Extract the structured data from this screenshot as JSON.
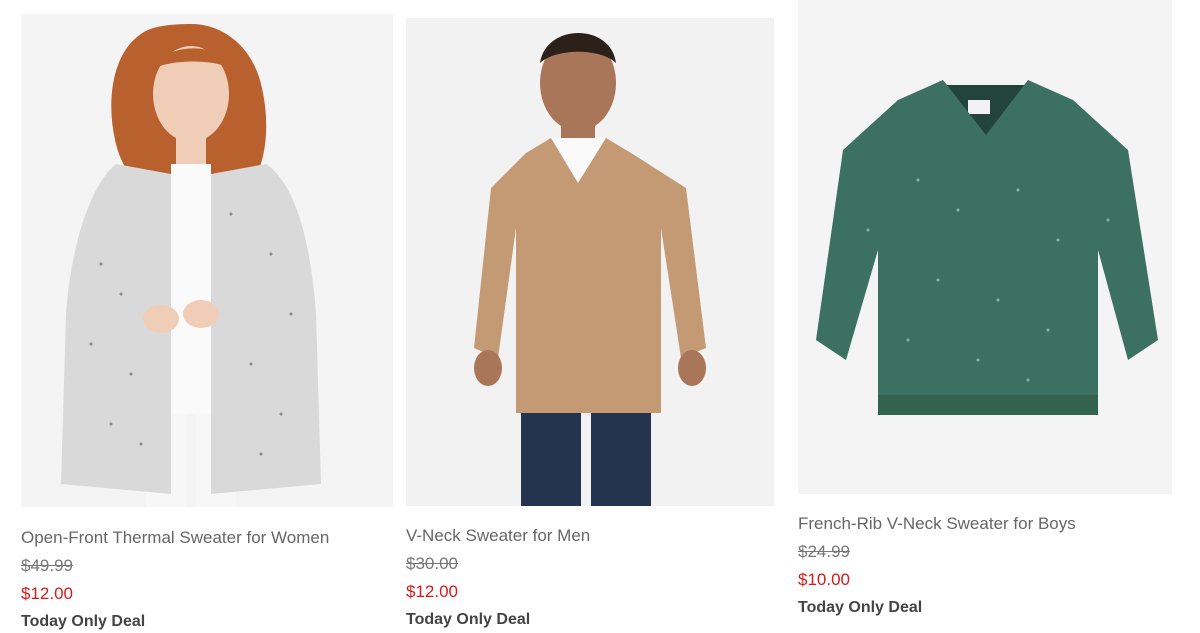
{
  "products": [
    {
      "name": "Open-Front Thermal Sweater for Women",
      "original_price": "$49.99",
      "sale_price": "$12.00",
      "deal": "Today Only Deal",
      "image_desc_color": "#dcdcdc"
    },
    {
      "name": "V-Neck Sweater for Men",
      "original_price": "$30.00",
      "sale_price": "$12.00",
      "deal": "Today Only Deal",
      "image_desc_color": "#c49a74"
    },
    {
      "name": "French-Rib V-Neck Sweater for Boys",
      "original_price": "$24.99",
      "sale_price": "$10.00",
      "deal": "Today Only Deal",
      "image_desc_color": "#3c7061"
    }
  ],
  "colors": {
    "sale_red": "#d41a1a",
    "title_gray": "#666666",
    "strike_gray": "#777777"
  }
}
